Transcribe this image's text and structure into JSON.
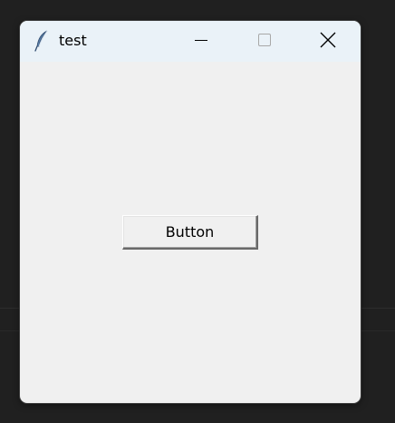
{
  "window": {
    "title": "test",
    "app_icon": "feather-icon"
  },
  "caption_buttons": {
    "minimize_icon": "minimize-icon",
    "maximize_icon": "maximize-icon",
    "close_icon": "close-icon"
  },
  "content": {
    "button_label": "Button"
  },
  "colors": {
    "desktop_background": "#202020",
    "titlebar_background": "#eaf2f8",
    "client_background": "#f0f0f0"
  }
}
